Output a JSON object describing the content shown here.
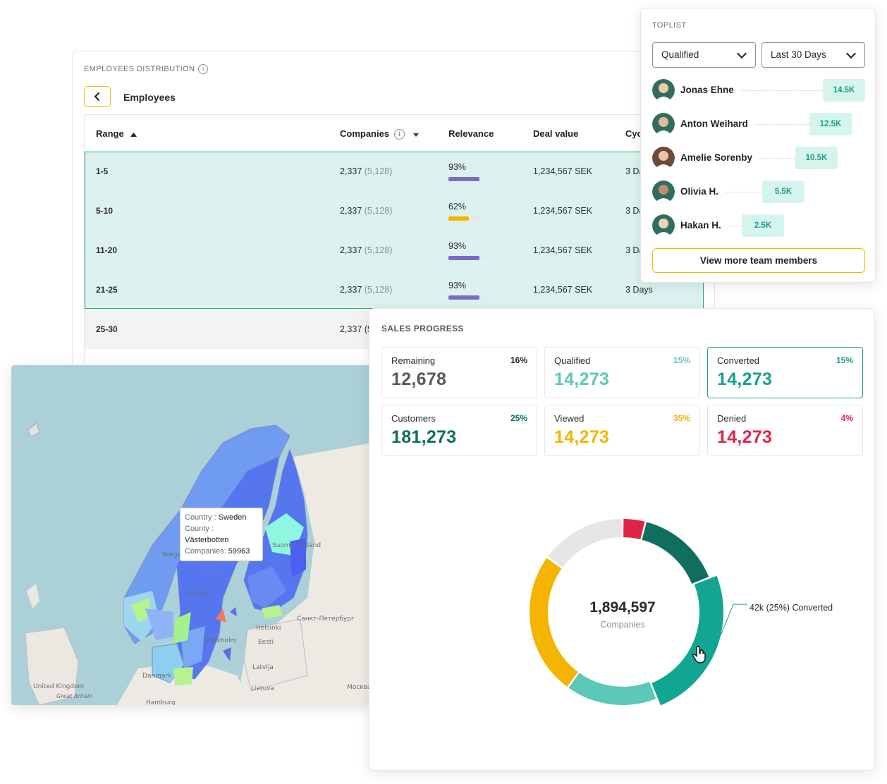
{
  "employees": {
    "title": "EMPLOYEES DISTRIBUTION",
    "crumb": "Employees",
    "columns": {
      "range": "Range",
      "companies": "Companies",
      "relevance": "Relevance",
      "deal_value": "Deal value",
      "cycle": "Cyc"
    },
    "rows": [
      {
        "range": "1-5",
        "companies": "2,337",
        "companies_total": "(5,128)",
        "relevance": "93%",
        "relevance_value": 93,
        "bar_color": "#7c6bc4",
        "deal": "1,234,567 SEK",
        "cycle": "3 Da"
      },
      {
        "range": "5-10",
        "companies": "2,337",
        "companies_total": "(5,128)",
        "relevance": "62%",
        "relevance_value": 62,
        "bar_color": "#f5b400",
        "deal": "1,234,567 SEK",
        "cycle": "3 Da"
      },
      {
        "range": "11-20",
        "companies": "2,337",
        "companies_total": "(5,128)",
        "relevance": "93%",
        "relevance_value": 93,
        "bar_color": "#7c6bc4",
        "deal": "1,234,567 SEK",
        "cycle": "3 Da"
      },
      {
        "range": "21-25",
        "companies": "2,337",
        "companies_total": "(5,128)",
        "relevance": "93%",
        "relevance_value": 93,
        "bar_color": "#7c6bc4",
        "deal": "1,234,567 SEK",
        "cycle": "3 Days"
      },
      {
        "range": "25-30",
        "companies": "2,337 (5",
        "companies_total": "",
        "relevance": "",
        "relevance_value": null,
        "bar_color": "",
        "deal": "",
        "cycle": ""
      }
    ]
  },
  "toplist": {
    "title": "TOPLIST",
    "filter_status": "Qualified",
    "filter_period": "Last 30 Days",
    "members": [
      {
        "name": "Jonas Ehne",
        "value": "14.5K",
        "share": 1.0
      },
      {
        "name": "Anton Weihard",
        "value": "12.5K",
        "share": 0.86
      },
      {
        "name": "Amelie Sorenby",
        "value": "10.5K",
        "share": 0.72
      },
      {
        "name": "Olivia H.",
        "value": "5.5K",
        "share": 0.38
      },
      {
        "name": "Hakan H.",
        "value": "2.5K",
        "share": 0.17
      }
    ],
    "more_label": "View more team members"
  },
  "map": {
    "tooltip": {
      "country_key": "Country :",
      "country": "Sweden",
      "county_key": "County :",
      "county": "Västerbotten",
      "companies_key": "Companies:",
      "companies": "59963"
    },
    "place_labels": [
      "Norge",
      "Sverige",
      "Suomi / Finland",
      "Helsinki",
      "Санкт-Петербург",
      "Eesti",
      "Stockholm",
      "Latvija",
      "Danmark",
      "Lietuva",
      "United Kingdom",
      "Great Britain",
      "Hamburg",
      "Москва"
    ]
  },
  "sales": {
    "title": "SALES PROGRESS",
    "stats": [
      {
        "label": "Remaining",
        "pct": "16%",
        "value": "12,678",
        "color": "#555a5e",
        "pct_color": "#222222",
        "active": false
      },
      {
        "label": "Qualified",
        "pct": "15%",
        "value": "14,273",
        "color": "#5cc8b7",
        "pct_color": "#5cc8b7",
        "active": false
      },
      {
        "label": "Converted",
        "pct": "15%",
        "value": "14,273",
        "color": "#19a08a",
        "pct_color": "#19a08a",
        "active": true
      },
      {
        "label": "Customers",
        "pct": "25%",
        "value": "181,273",
        "color": "#0f6e5e",
        "pct_color": "#0f6e5e",
        "active": false
      },
      {
        "label": "Viewed",
        "pct": "35%",
        "value": "14,273",
        "color": "#f5b400",
        "pct_color": "#f5b400",
        "active": false
      },
      {
        "label": "Denied",
        "pct": "4%",
        "value": "14,273",
        "color": "#e02447",
        "pct_color": "#e02447",
        "active": false
      }
    ],
    "donut": {
      "total": "1,894,597",
      "total_label": "Companies",
      "callout": "42k (25%) Converted",
      "segments": [
        {
          "name": "Denied",
          "share": 4,
          "color": "#e02447"
        },
        {
          "name": "Customers",
          "share": 15,
          "color": "#0f6e5e"
        },
        {
          "name": "Converted",
          "share": 25,
          "color": "#12a592",
          "highlight": true
        },
        {
          "name": "Qualified",
          "share": 16,
          "color": "#5cc8b7"
        },
        {
          "name": "Viewed",
          "share": 25,
          "color": "#f5b400"
        },
        {
          "name": "Remaining",
          "share": 15,
          "color": "#e6e6e6"
        }
      ]
    }
  }
}
